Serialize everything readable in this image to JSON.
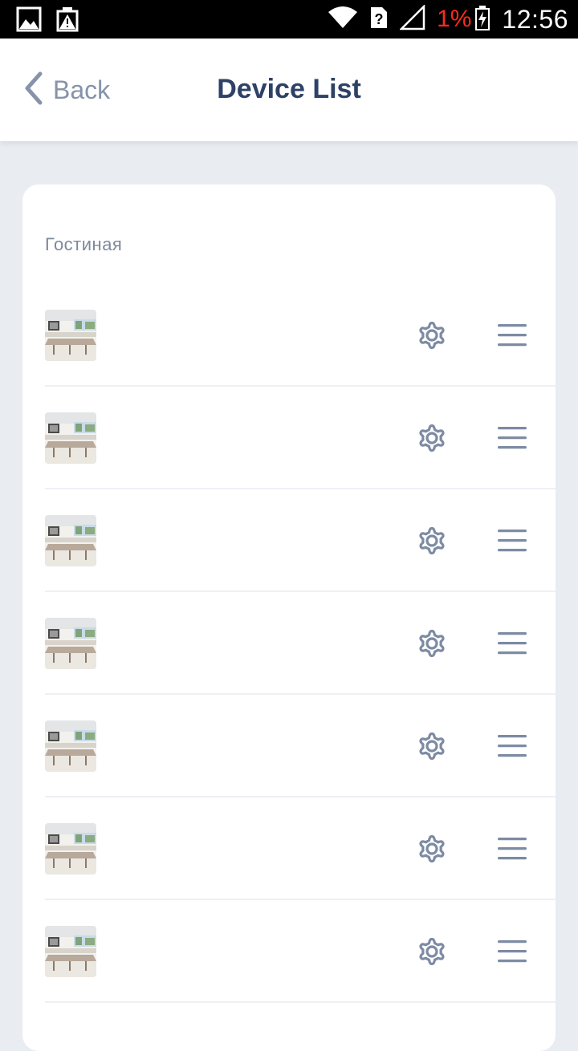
{
  "status_bar": {
    "battery_percent": "1%",
    "time": "12:56",
    "battery_color": "#ff2a1a",
    "icons": [
      "image-icon",
      "alert-icon",
      "wifi-icon",
      "sim-unknown-icon",
      "cell-signal-icon",
      "battery-charging-icon"
    ]
  },
  "header": {
    "back_label": "Back",
    "title": "Device List"
  },
  "group": {
    "label": "Гостиная"
  },
  "devices": [
    {
      "thumbnail": "room-thumbnail",
      "actions": [
        "gear-icon",
        "menu-icon"
      ]
    },
    {
      "thumbnail": "room-thumbnail",
      "actions": [
        "gear-icon",
        "menu-icon"
      ]
    },
    {
      "thumbnail": "room-thumbnail",
      "actions": [
        "gear-icon",
        "menu-icon"
      ]
    },
    {
      "thumbnail": "room-thumbnail",
      "actions": [
        "gear-icon",
        "menu-icon"
      ]
    },
    {
      "thumbnail": "room-thumbnail",
      "actions": [
        "gear-icon",
        "menu-icon"
      ]
    },
    {
      "thumbnail": "room-thumbnail",
      "actions": [
        "gear-icon",
        "menu-icon"
      ]
    },
    {
      "thumbnail": "room-thumbnail",
      "actions": [
        "gear-icon",
        "menu-icon"
      ]
    }
  ],
  "colors": {
    "background": "#e9ecf1",
    "title": "#2e4166",
    "icon": "#7d8ba3",
    "muted_text": "#8693aa"
  }
}
